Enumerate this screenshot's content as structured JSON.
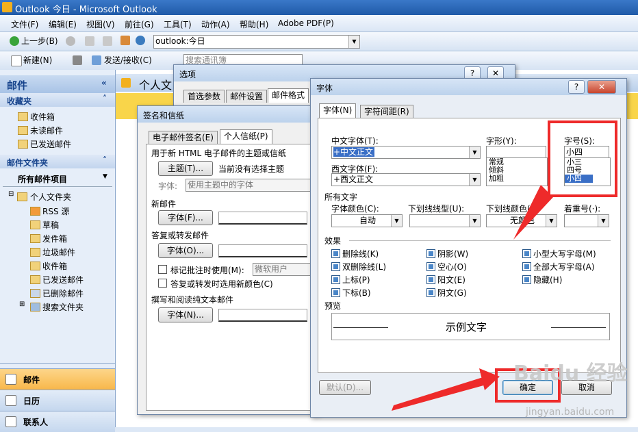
{
  "window": {
    "title": "Outlook 今日 - Microsoft Outlook"
  },
  "menubar": [
    "文件(F)",
    "编辑(E)",
    "视图(V)",
    "前往(G)",
    "工具(T)",
    "动作(A)",
    "帮助(H)",
    "Adobe PDF(P)"
  ],
  "toolbar1": {
    "back_label": "上一步(B)",
    "address_value": "outlook:今日"
  },
  "toolbar2": {
    "new_label": "新建(N)",
    "send_receive_label": "发送/接收(C)",
    "search_placeholder": "搜索通讯簿"
  },
  "navpane": {
    "title": "邮件",
    "favorites_header": "收藏夹",
    "favorites": [
      "收件箱",
      "未读邮件",
      "已发送邮件"
    ],
    "mail_folders_header": "邮件文件夹",
    "all_items_label": "所有邮件项目",
    "root_folder": "个人文件夹",
    "folders": [
      "RSS 源",
      "草稿",
      "发件箱",
      "垃圾邮件",
      "收件箱",
      "已发送邮件",
      "已删除邮件",
      "搜索文件夹"
    ],
    "buttons": [
      "邮件",
      "日历",
      "联系人"
    ]
  },
  "content": {
    "header_text": "个人文"
  },
  "options_dialog": {
    "title": "选项",
    "tabs": [
      "首选参数",
      "邮件设置",
      "邮件格式"
    ]
  },
  "signature_dialog": {
    "title": "签名和信纸",
    "tabs": [
      "电子邮件签名(E)",
      "个人信纸(P)"
    ],
    "theme_label": "用于新 HTML 电子邮件的主题或信纸",
    "theme_button": "主题(T)...",
    "no_theme_text": "当前没有选择主题",
    "font_label": "字体:",
    "font_value": "使用主题中的字体",
    "new_mail_label": "新邮件",
    "font_button": "字体(F)...",
    "reply_label": "答复或转发邮件",
    "reply_font_button": "字体(O)...",
    "mark_comments_label": "标记批注时使用(M):",
    "mark_comments_value": "微软用户",
    "pick_color_label": "答复或转发时选用新颜色(C)",
    "plain_text_label": "撰写和阅读纯文本邮件",
    "plain_font_button": "字体(N)..."
  },
  "font_dialog": {
    "title": "字体",
    "tabs": [
      "字体(N)",
      "字符间距(R)"
    ],
    "chinese_font_label": "中文字体(T):",
    "chinese_font_value": "+中文正文",
    "western_font_label": "西文字体(F):",
    "western_font_value": "+西文正文",
    "style_label": "字形(Y):",
    "style_options": [
      "常规",
      "倾斜",
      "加粗"
    ],
    "size_label": "字号(S):",
    "size_value": "小四",
    "size_options": [
      "小三",
      "四号",
      "小四"
    ],
    "all_text_label": "所有文字",
    "font_color_label": "字体颜色(C):",
    "font_color_value": "自动",
    "underline_type_label": "下划线线型(U):",
    "underline_color_label": "下划线颜色(I):",
    "underline_color_value": "无颜色",
    "emphasis_label": "着重号(·):",
    "effects_label": "效果",
    "effects": [
      {
        "label": "删除线(K)"
      },
      {
        "label": "阴影(W)"
      },
      {
        "label": "小型大写字母(M)"
      },
      {
        "label": "双删除线(L)"
      },
      {
        "label": "空心(O)"
      },
      {
        "label": "全部大写字母(A)"
      },
      {
        "label": "上标(P)"
      },
      {
        "label": "阳文(E)"
      },
      {
        "label": "隐藏(H)"
      },
      {
        "label": "下标(B)"
      },
      {
        "label": "阴文(G)"
      }
    ],
    "preview_label": "预览",
    "preview_text": "示例文字",
    "default_button": "默认(D)...",
    "ok_button": "确定",
    "cancel_button": "取消"
  },
  "watermark": {
    "text": "Baidu 经验",
    "subtext": "jingyan.baidu.com"
  },
  "colors": {
    "highlight": "#ee2a2a",
    "nav_selected": "#f8b74a",
    "title_blue": "#1f5aa8"
  }
}
